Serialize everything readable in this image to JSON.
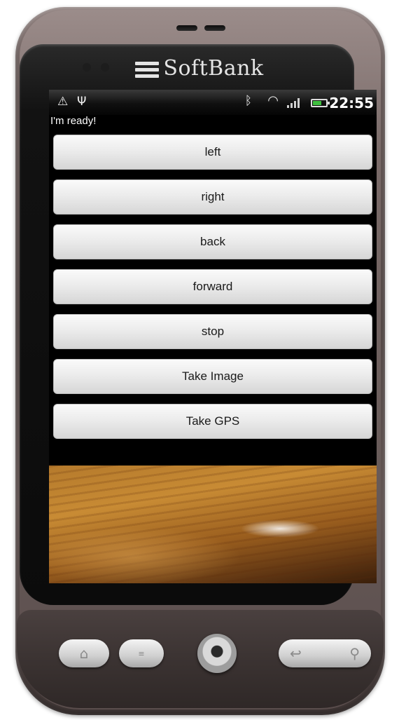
{
  "device": {
    "brand": "SoftBank"
  },
  "statusbar": {
    "left_icons": [
      "warning-icon",
      "usb-icon"
    ],
    "right_icons": [
      "bluetooth-icon",
      "wifi-icon",
      "signal-icon",
      "battery-icon"
    ],
    "time": "22:55"
  },
  "app": {
    "status_text": "I'm ready!",
    "buttons": [
      {
        "label": "left"
      },
      {
        "label": "right"
      },
      {
        "label": "back"
      },
      {
        "label": "forward"
      },
      {
        "label": "stop"
      },
      {
        "label": "Take Image"
      },
      {
        "label": "Take GPS"
      }
    ],
    "camera_preview": "camera-preview"
  },
  "hardware_keys": {
    "left": [
      "home-icon",
      "menu-icon"
    ],
    "center": "trackball",
    "right": [
      "back-icon",
      "search-icon"
    ]
  },
  "colors": {
    "screen_bg": "#000000",
    "button_bg": "#ececec",
    "battery": "#3fbf3f"
  }
}
